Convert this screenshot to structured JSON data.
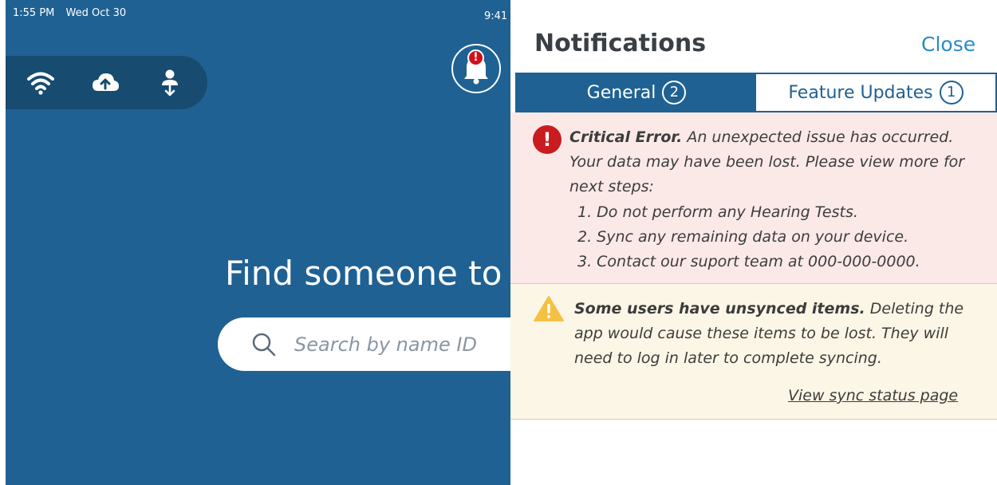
{
  "status_bar": {
    "time": "1:55 PM",
    "date": "Wed Oct 30",
    "secondary_time": "9:41"
  },
  "toolbar": {
    "icons": [
      "wifi-icon",
      "cloud-upload-icon",
      "person-sync-icon"
    ]
  },
  "bell": {
    "icon": "bell-icon",
    "badge": "!"
  },
  "main": {
    "title": "Find someone to",
    "search_placeholder": "Search by name ID"
  },
  "notifications": {
    "title": "Notifications",
    "close_label": "Close",
    "tabs": [
      {
        "label": "General",
        "count": "2"
      },
      {
        "label": "Feature Updates",
        "count": "1"
      }
    ],
    "critical": {
      "icon": "error-icon",
      "lead": "Critical Error.",
      "body": " An unexpected issue has occurred. Your data may have been lost. Please view more for next steps:",
      "steps": [
        "1. Do not perform any Hearing Tests.",
        "2. Sync any remaining data on your device.",
        "3. Contact our suport team at 000-000-0000."
      ]
    },
    "warning": {
      "icon": "warning-icon",
      "lead": "Some users have unsynced items.",
      "body": " Deleting the app would cause these items to be lost. They will need to log in later to complete syncing.",
      "link": "View sync status page"
    }
  },
  "colors": {
    "app_blue": "#1f6193",
    "toolbar_blue": "#174b70",
    "accent_link": "#2a8bc7",
    "critical_bg": "#fbe9e8",
    "warning_bg": "#fcf6e6",
    "error_red": "#c81c20",
    "warning_yellow": "#f6c142"
  }
}
